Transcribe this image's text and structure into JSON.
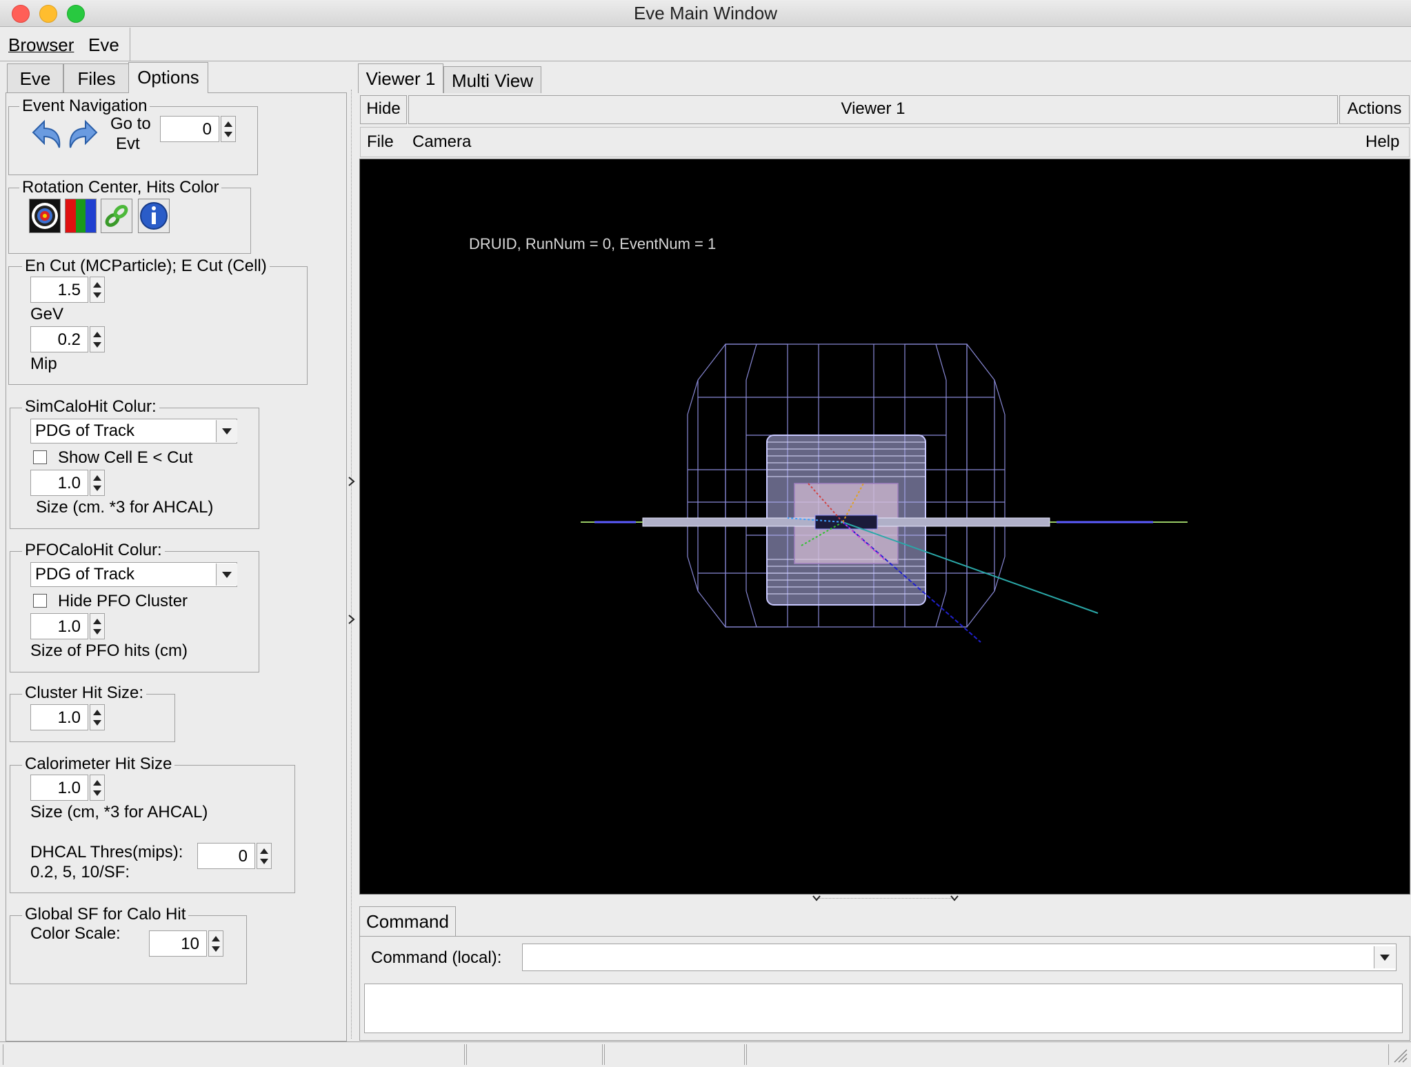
{
  "window": {
    "title": "Eve Main Window"
  },
  "menubar": {
    "items": [
      "Browser",
      "Eve"
    ]
  },
  "left_tabs": [
    "Eve",
    "Files",
    "Options"
  ],
  "event_navigation": {
    "title": "Event Navigation",
    "goto_label_line1": "Go to",
    "goto_label_line2": "Evt",
    "goto_value": "0"
  },
  "rotation_center": {
    "title": "Rotation Center, Hits Color"
  },
  "en_cut": {
    "title": "En Cut (MCParticle); E Cut (Cell)",
    "gev_value": "1.5",
    "gev_label": "GeV",
    "mip_value": "0.2",
    "mip_label": "Mip"
  },
  "sim_calo": {
    "title": "SimCaloHit Colur:",
    "combo_value": "PDG of Track",
    "checkbox_label": "Show Cell E < Cut",
    "size_value": "1.0",
    "size_label": "Size (cm. *3 for AHCAL)"
  },
  "pfo_calo": {
    "title": "PFOCaloHit Colur:",
    "combo_value": "PDG of Track",
    "checkbox_label": "Hide PFO Cluster",
    "size_value": "1.0",
    "size_label": "Size of PFO hits (cm)"
  },
  "cluster_hit": {
    "title": "Cluster Hit Size:",
    "value": "1.0"
  },
  "calorimeter_hit": {
    "title": "Calorimeter Hit Size",
    "value": "1.0",
    "size_label": "Size (cm, *3 for AHCAL)",
    "dhcal_label_line1": "DHCAL Thres(mips):",
    "dhcal_label_line2": "0.2, 5, 10/SF:",
    "dhcal_value": "0"
  },
  "global_sf": {
    "title": "Global SF for Calo Hit",
    "color_scale_label": "Color Scale:",
    "value": "10"
  },
  "right_tabs": [
    "Viewer 1",
    "Multi View"
  ],
  "viewer_bar": {
    "hide": "Hide",
    "title": "Viewer 1",
    "actions": "Actions"
  },
  "viewer_menu": {
    "file": "File",
    "camera": "Camera",
    "help": "Help"
  },
  "viewer_overlay": "DRUID, RunNum = 0, EventNum = 1",
  "command": {
    "tab": "Command",
    "label": "Command (local):",
    "value": ""
  },
  "colors": {
    "viewer_bg": "#000000",
    "detector_wire": "#8f8fe0",
    "beam": "#99cc66"
  }
}
